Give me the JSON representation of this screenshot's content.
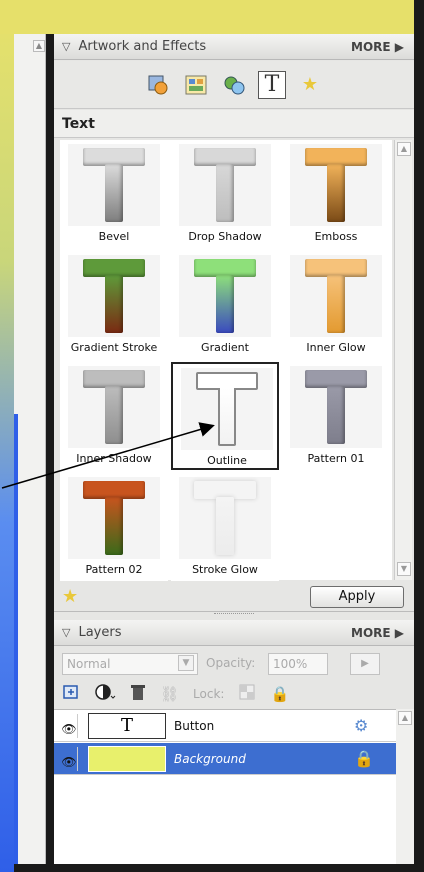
{
  "artwork_panel": {
    "title": "Artwork and Effects",
    "more": "MORE ▶",
    "section_label": "Text",
    "effects": [
      {
        "label": "Bevel",
        "colors": [
          "#dcdcdc",
          "#7e7e7e"
        ]
      },
      {
        "label": "Drop Shadow",
        "colors": [
          "#d8d8d8",
          "#bdbdbd"
        ]
      },
      {
        "label": "Emboss",
        "colors": [
          "#f2b35a",
          "#7a4a16"
        ]
      },
      {
        "label": "Gradient Stroke",
        "colors": [
          "#5e9a3a",
          "#7a2a12"
        ]
      },
      {
        "label": "Gradient",
        "colors": [
          "#8ee07a",
          "#3a4abf"
        ]
      },
      {
        "label": "Inner Glow",
        "colors": [
          "#f6c27a",
          "#e39a30"
        ]
      },
      {
        "label": "Inner Shadow",
        "colors": [
          "#bdbdbd",
          "#8e8e8e"
        ]
      },
      {
        "label": "Outline",
        "colors": [
          "#ffffff",
          "#f2f2f2"
        ]
      },
      {
        "label": "Pattern 01",
        "colors": [
          "#9a9aa8",
          "#7e7e8c"
        ]
      },
      {
        "label": "Pattern 02",
        "colors": [
          "#c8541e",
          "#3a6a1a"
        ]
      },
      {
        "label": "Stroke Glow",
        "colors": [
          "#f4f4f4",
          "#ececec"
        ]
      }
    ],
    "selected_effect": "Outline",
    "apply_label": "Apply"
  },
  "layers_panel": {
    "title": "Layers",
    "more": "MORE ▶",
    "blend_mode": "Normal",
    "opacity_label": "Opacity:",
    "opacity_value": "100%",
    "lock_label": "Lock:",
    "layers": [
      {
        "name": "Button",
        "thumb": "T",
        "selected": false
      },
      {
        "name": "Background",
        "thumb": "",
        "selected": true
      }
    ]
  },
  "icons": {
    "tabs": [
      "artwork-icon",
      "graphics-icon",
      "effects-icon",
      "text-effects-icon",
      "favorites-icon"
    ],
    "toolbar": [
      "new-layer-icon",
      "adjustment-layer-icon",
      "trash-icon",
      "link-icon",
      "lock-transparent-icon",
      "lock-all-icon"
    ]
  }
}
